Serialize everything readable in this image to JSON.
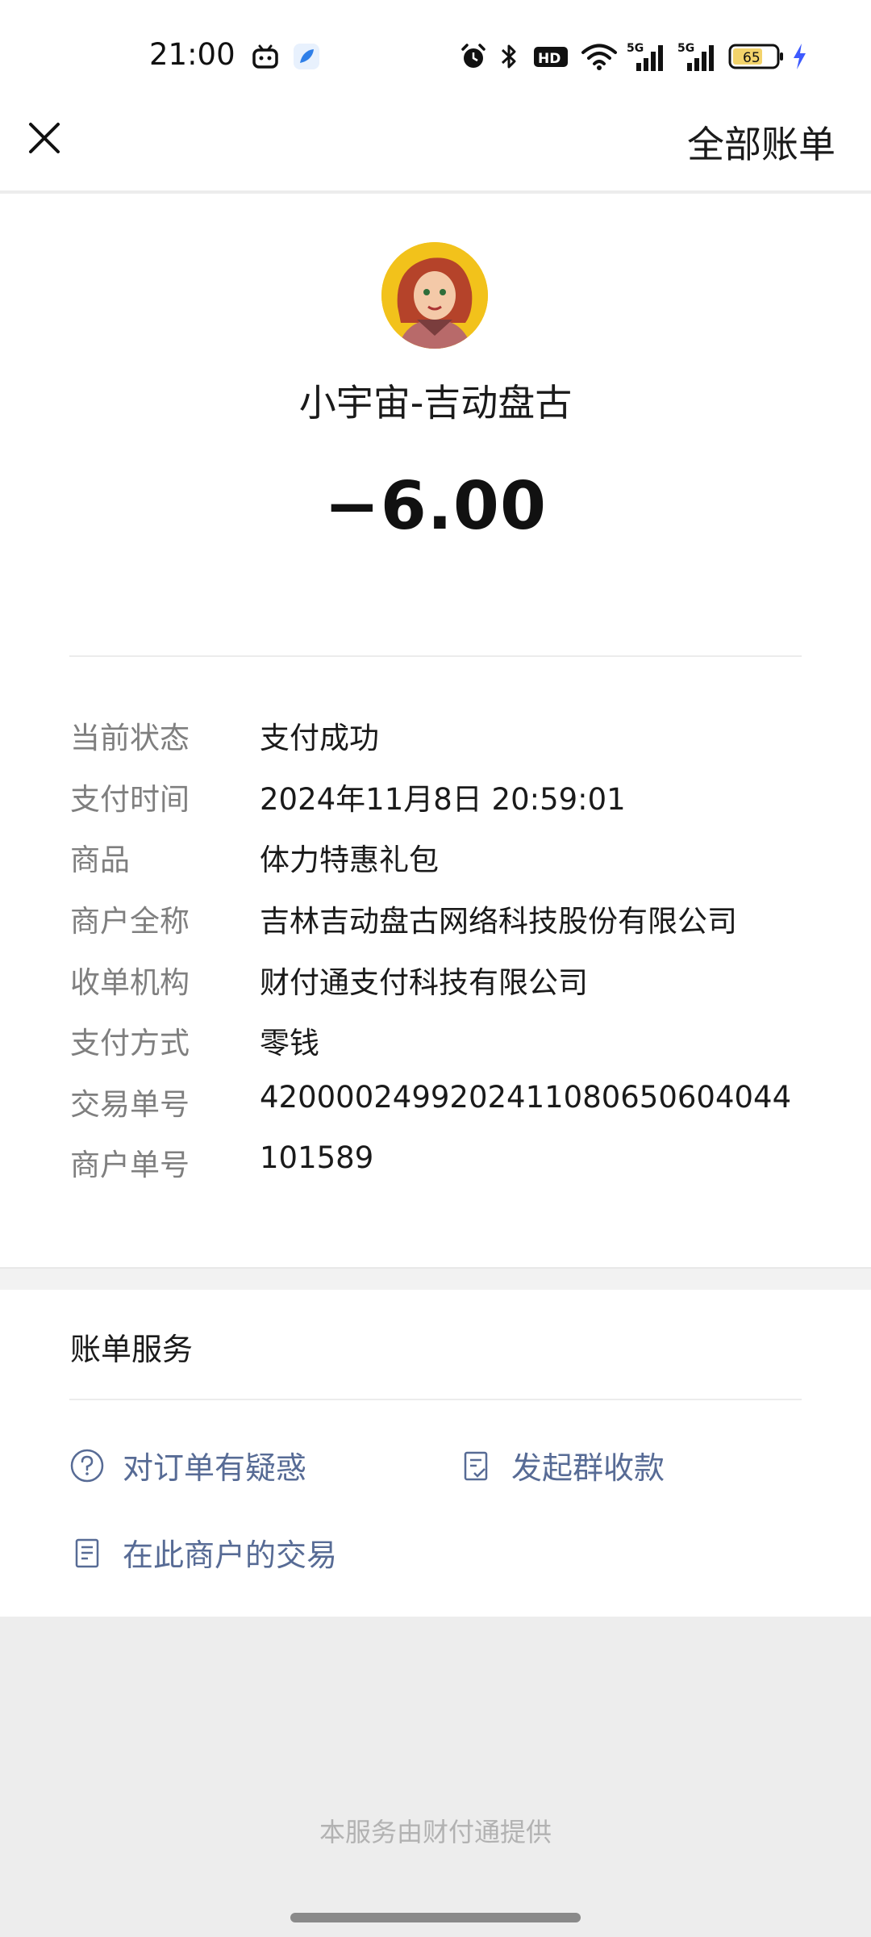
{
  "status_bar": {
    "time": "21:00",
    "network_1": "5G",
    "network_2": "5G",
    "hd_badge": "HD",
    "battery": "65",
    "icons": [
      "bilibili-icon",
      "feather-app-icon",
      "alarm-icon",
      "bluetooth-icon",
      "hd-icon",
      "wifi-icon",
      "signal-icon",
      "signal-icon",
      "battery-icon",
      "charging-icon"
    ]
  },
  "header": {
    "close_icon": "close-icon",
    "all_bills_label": "全部账单"
  },
  "merchant": {
    "name": "小宇宙-吉动盘古",
    "amount": "−6.00"
  },
  "details": [
    {
      "label": "当前状态",
      "value": "支付成功"
    },
    {
      "label": "支付时间",
      "value": "2024年11月8日 20:59:01"
    },
    {
      "label": "商品",
      "value": "体力特惠礼包"
    },
    {
      "label": "商户全称",
      "value": "吉林吉动盘古网络科技股份有限公司"
    },
    {
      "label": "收单机构",
      "value": "财付通支付科技有限公司"
    },
    {
      "label": "支付方式",
      "value": "零钱"
    },
    {
      "label": "交易单号",
      "value": "4200002499202411080650604044"
    },
    {
      "label": "商户单号",
      "value": "101589"
    }
  ],
  "services": {
    "title": "账单服务",
    "items": [
      {
        "label": "对订单有疑惑",
        "icon": "question-circle-icon"
      },
      {
        "label": "发起群收款",
        "icon": "checklist-icon"
      },
      {
        "label": "在此商户的交易",
        "icon": "document-icon"
      }
    ]
  },
  "footer": {
    "text": "本服务由财付通提供"
  },
  "colors": {
    "link": "#576b95",
    "label": "#7f7f7f",
    "page_bg": "#ededed"
  }
}
